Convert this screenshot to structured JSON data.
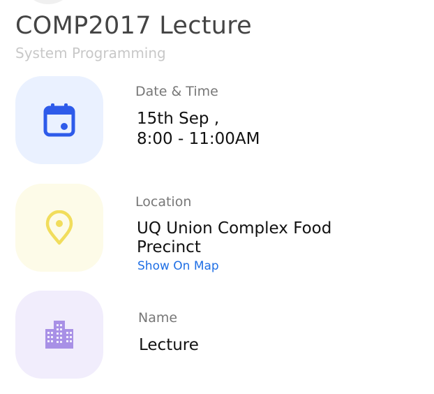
{
  "header": {
    "title": "COMP2017 Lecture",
    "subtitle": "System Programming"
  },
  "details": {
    "datetime": {
      "label": "Date & Time",
      "line1": "15th Sep ,",
      "line2": "8:00 - 11:00AM",
      "icon": "calendar-icon",
      "tile_color": "#eaf1ff",
      "icon_color": "#2e5bea"
    },
    "location": {
      "label": "Location",
      "line1": "UQ Union Complex Food",
      "line2": "Precinct",
      "link": "Show On Map",
      "icon": "map-pin-icon",
      "tile_color": "#fdfbe8",
      "icon_color": "#f1dd5c"
    },
    "name": {
      "label": "Name",
      "value": "Lecture",
      "icon": "building-icon",
      "tile_color": "#f1edfc",
      "icon_color": "#a890e6"
    }
  }
}
